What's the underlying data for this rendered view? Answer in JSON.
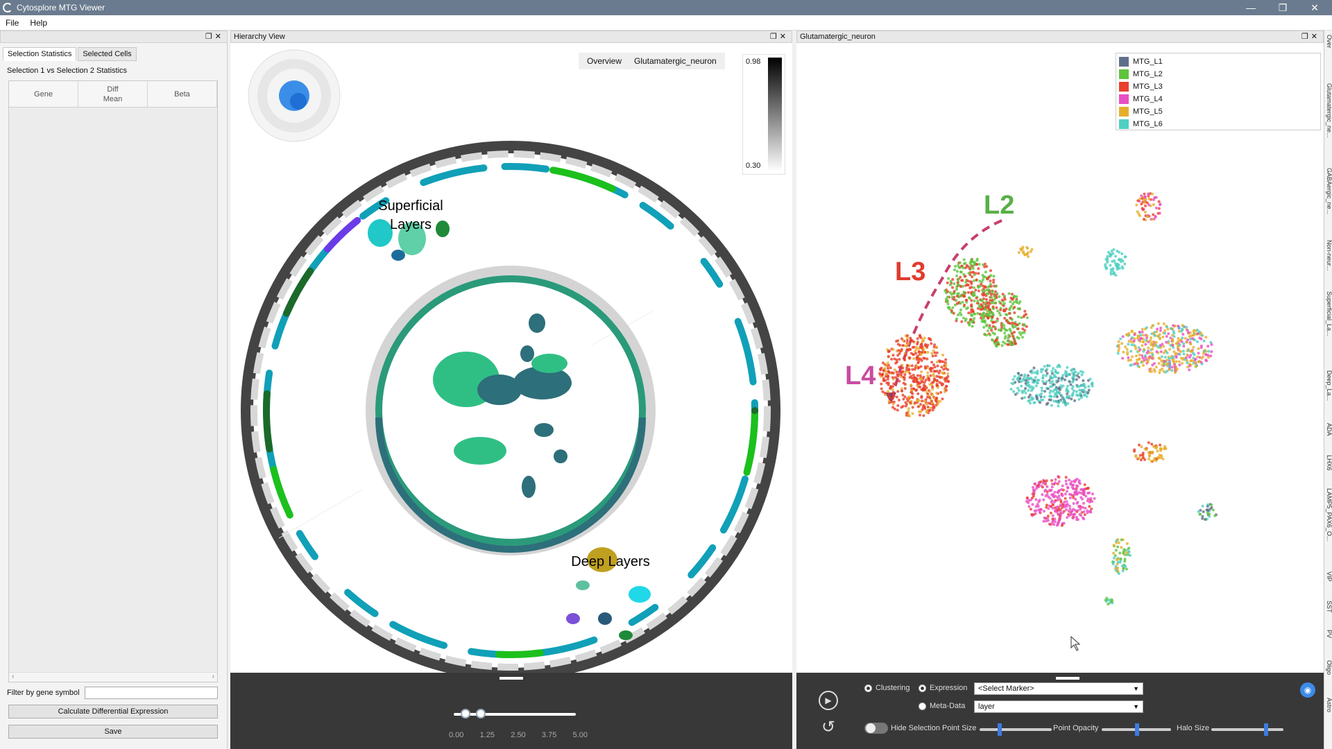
{
  "app": {
    "title": "Cytosplore MTG Viewer",
    "menu": [
      "File",
      "Help"
    ]
  },
  "left_panel": {
    "tabs": [
      "Selection Statistics",
      "Selected Cells"
    ],
    "subtitle": "Selection 1 vs Selection 2 Statistics",
    "columns": [
      "Gene",
      "Diff\nMean",
      "Beta"
    ],
    "filter_label": "Filter by gene symbol",
    "filter_value": "",
    "calc_button": "Calculate Differential Expression",
    "save_button": "Save"
  },
  "hierarchy": {
    "title": "Hierarchy View",
    "breadcrumbs": [
      "Overview",
      "Glutamatergic_neuron"
    ],
    "colorbar": {
      "max": "0.98",
      "min": "0.30"
    },
    "labels": {
      "superficial": "Superficial\nLayers",
      "deep": "Deep Layers"
    },
    "slider": {
      "ticks": [
        "0.00",
        "1.25",
        "2.50",
        "3.75",
        "5.00"
      ]
    }
  },
  "embedding": {
    "title": "Glutamatergic_neuron",
    "legend": [
      {
        "label": "MTG_L1",
        "color": "#60708a"
      },
      {
        "label": "MTG_L2",
        "color": "#5ec43c"
      },
      {
        "label": "MTG_L3",
        "color": "#e8402c"
      },
      {
        "label": "MTG_L4",
        "color": "#ea4fc4"
      },
      {
        "label": "MTG_L5",
        "color": "#e6ae2a"
      },
      {
        "label": "MTG_L6",
        "color": "#4fd0c0"
      }
    ],
    "annotations": {
      "l2": "L2",
      "l3": "L3",
      "l4": "L4"
    },
    "controls": {
      "clustering": "Clustering",
      "expression": "Expression",
      "metadata": "Meta-Data",
      "marker_select": "<Select Marker>",
      "meta_select": "layer",
      "hide_selection": "Hide Selection",
      "point_size": "Point Size",
      "point_opacity": "Point Opacity",
      "halo_size": "Halo Size"
    }
  },
  "right_tabs": [
    "Over",
    "Glutamatergic_ne...",
    "GABAergic_ne...",
    "Non-neur...",
    "Superficial_La...",
    "Deep_La...",
    "ADA",
    "LHX6",
    "LAMP5_PAX6_O...",
    "VIP",
    "SST",
    "PV",
    "Oligo",
    "Astro"
  ]
}
